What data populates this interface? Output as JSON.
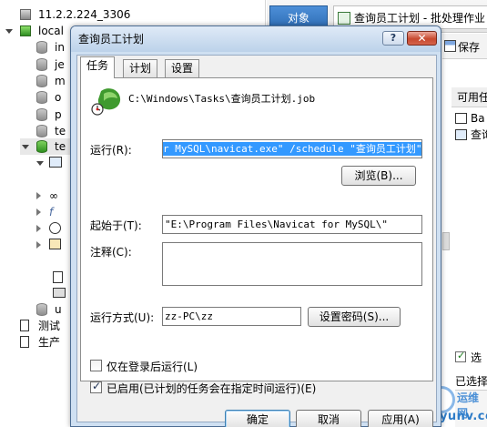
{
  "tree": {
    "connection_1": "11.2.2.224_3306",
    "connection_2": "local",
    "db_items": [
      "in",
      "je",
      "m",
      "o",
      "p",
      "te"
    ],
    "selected_db": "te",
    "sub_item_u": "u",
    "group_1": "测试",
    "group_2": "生产"
  },
  "top_tabs": {
    "object": "对象",
    "batch_job": "查询员工计划 - 批处理作业"
  },
  "toolbar": {
    "save": "保存"
  },
  "available": {
    "header": "可用任",
    "item_1": "Ba",
    "item_2": "查询"
  },
  "right_bottom": {
    "checkbox_label": "选",
    "selected_label": "已选择"
  },
  "watermark": {
    "top": "运维网",
    "bottom": "iyunv.com"
  },
  "dialog": {
    "title": "查询员工计划",
    "help": "?",
    "close": "✕",
    "tabs": [
      "任务",
      "计划",
      "设置"
    ],
    "job_path": "C:\\Windows\\Tasks\\查询员工计划.job",
    "run_label": "运行(R):",
    "run_value_selected": "r MySQL\\navicat.exe\" /schedule \"查询员工计划\"",
    "browse_button": "浏览(B)...",
    "start_in_label": "起始于(T):",
    "start_in_value": "\"E:\\Program Files\\Navicat for MySQL\\\"",
    "comment_label": "注释(C):",
    "comment_value": "",
    "run_as_label": "运行方式(U):",
    "run_as_value": "zz-PC\\zz",
    "set_password_button": "设置密码(S)...",
    "only_logged_on_label": "仅在登录后运行(L)",
    "only_logged_on_checked": false,
    "enabled_label": "已启用(已计划的任务会在指定时间运行)(E)",
    "enabled_checked": true,
    "ok_button": "确定",
    "cancel_button": "取消",
    "apply_button": "应用(A)"
  }
}
